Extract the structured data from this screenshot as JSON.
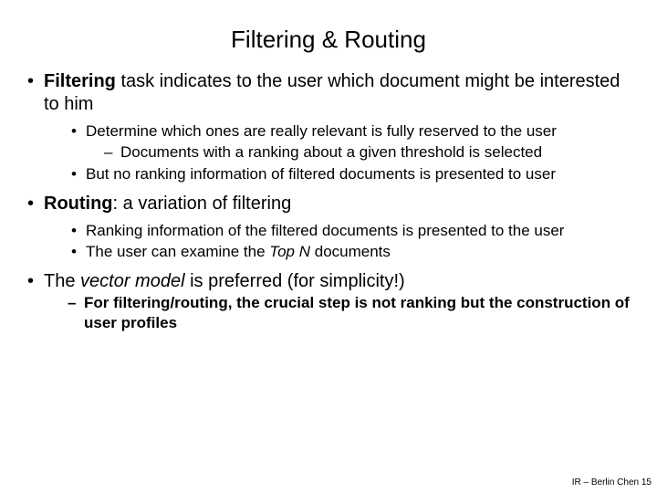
{
  "title": "Filtering & Routing",
  "b1_bold": "Filtering",
  "b1_rest": " task indicates to the user which document might be interested to him",
  "b1_sub1": "Determine which ones are really relevant is fully reserved to the user",
  "b1_sub1_d1": "Documents with a ranking about a given threshold is selected",
  "b1_sub2": "But no ranking information of filtered documents is presented to user",
  "b2_bold": "Routing",
  "b2_rest": ": a variation of filtering",
  "b2_sub1": "Ranking information of the filtered documents is presented to the user",
  "b2_sub2_a": "The user can examine the ",
  "b2_sub2_i": "Top N",
  "b2_sub2_c": " documents",
  "b3_a": "The ",
  "b3_i": "vector model",
  "b3_c": " is preferred (for simplicity!)",
  "b3_d1": "For filtering/routing, the crucial step is not ranking but the construction of user profiles",
  "footer": "IR – Berlin Chen 15"
}
